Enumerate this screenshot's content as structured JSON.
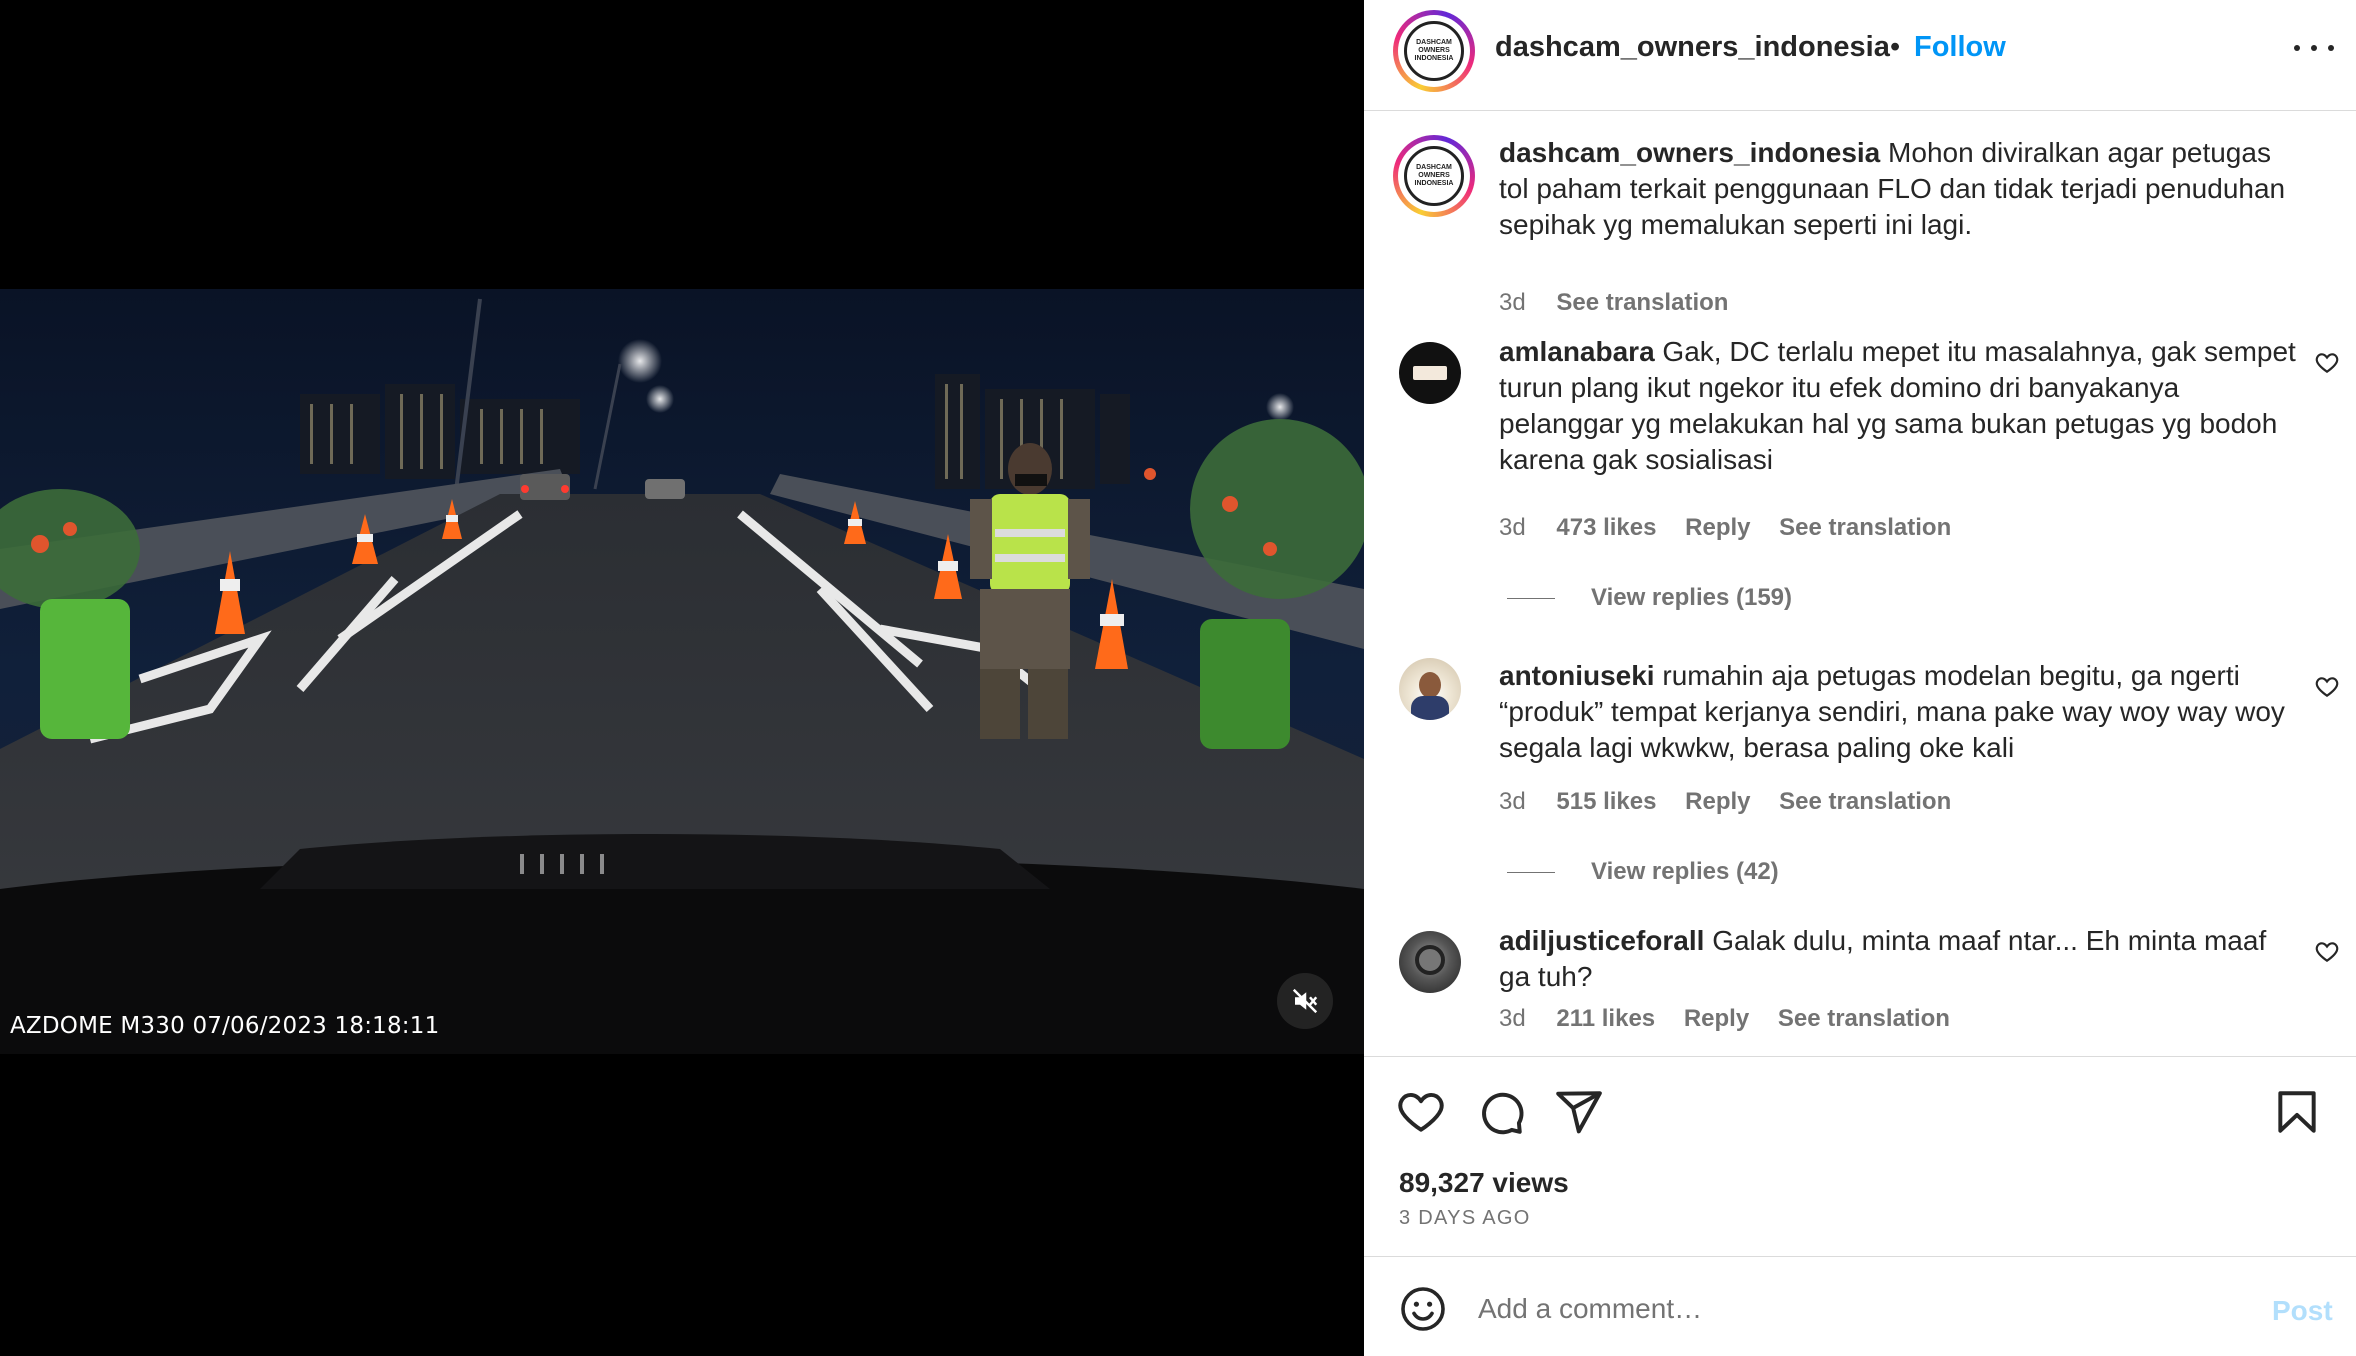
{
  "media": {
    "dashcam_stamp": "AZDOME M330 07/06/2023 18:18:11",
    "mute_icon": "speaker-muted-icon"
  },
  "header": {
    "username": "dashcam_owners_indonesia",
    "separator": "•",
    "follow_label": "Follow",
    "avatar_text": "DASHCAM OWNERS INDONESIA"
  },
  "caption": {
    "username": "dashcam_owners_indonesia",
    "text": "Mohon diviralkan agar petugas tol paham terkait penggunaan FLO dan tidak terjadi penuduhan sepihak yg memalukan seperti ini lagi.",
    "time": "3d",
    "see_translation": "See translation"
  },
  "comments": [
    {
      "username": "amlanabara",
      "text": "Gak, DC terlalu mepet itu masalahnya, gak sempet turun plang ikut ngekor itu efek domino dri banyakanya pelanggar yg melakukan hal yg sama bukan petugas yg bodoh karena gak sosialisasi",
      "time": "3d",
      "likes": "473 likes",
      "reply": "Reply",
      "see_translation": "See translation",
      "view_replies": "View replies (159)"
    },
    {
      "username": "antoniuseki",
      "text": "rumahin aja petugas modelan begitu, ga ngerti “produk” tempat kerjanya sendiri, mana pake way woy way woy segala lagi wkwkw, berasa paling oke kali",
      "time": "3d",
      "likes": "515 likes",
      "reply": "Reply",
      "see_translation": "See translation",
      "view_replies": "View replies (42)"
    },
    {
      "username": "adiljusticeforall",
      "text": "Galak dulu, minta maaf ntar... Eh minta maaf ga tuh?",
      "time": "3d",
      "likes": "211 likes",
      "reply": "Reply",
      "see_translation": "See translation"
    }
  ],
  "actions": {
    "like_icon": "heart-icon",
    "comment_icon": "comment-bubble-icon",
    "share_icon": "paper-plane-icon",
    "save_icon": "bookmark-icon",
    "views": "89,327 views",
    "posted": "3 DAYS AGO"
  },
  "comment_box": {
    "placeholder": "Add a comment…",
    "post_label": "Post"
  },
  "colors": {
    "accent": "#0095f6",
    "post_disabled": "#b2dffc",
    "muted_text": "#737373",
    "divider": "#dbdbdb"
  }
}
